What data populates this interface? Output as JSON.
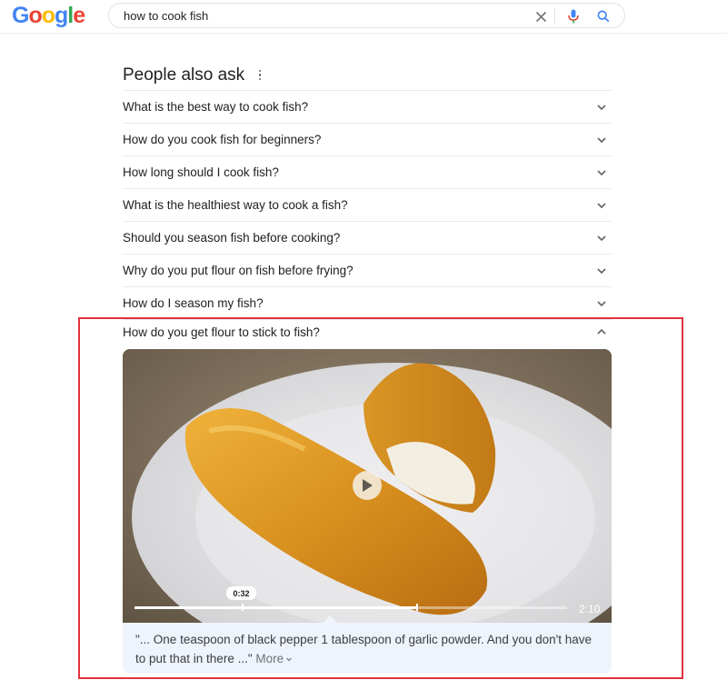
{
  "header": {
    "logo_letters": [
      {
        "ch": "G",
        "color": "#4285f4"
      },
      {
        "ch": "o",
        "color": "#ea4335"
      },
      {
        "ch": "o",
        "color": "#fbbc05"
      },
      {
        "ch": "g",
        "color": "#4285f4"
      },
      {
        "ch": "l",
        "color": "#34a853"
      },
      {
        "ch": "e",
        "color": "#ea4335"
      }
    ],
    "search_value": "how to cook fish"
  },
  "paa": {
    "title": "People also ask",
    "questions": [
      "What is the best way to cook fish?",
      "How do you cook fish for beginners?",
      "How long should I cook fish?",
      "What is the healthiest way to cook a fish?",
      "Should you season fish before cooking?",
      "Why do you put flour on fish before frying?",
      "How do I season my fish?"
    ],
    "expanded": {
      "question": "How do you get flour to stick to fish?",
      "video": {
        "current_time": "0:32",
        "duration": "2:10",
        "progress_fraction": 0.25
      },
      "snippet": "\"... One teaspoon of black pepper 1 tablespoon of garlic powder. And you don't have to put that in there ...\"",
      "more_label": "More"
    }
  },
  "colors": {
    "highlight_border": "#e0323c",
    "snippet_bg": "#eef3fc",
    "mic_blue": "#4285f4",
    "mic_red": "#ea4335"
  }
}
